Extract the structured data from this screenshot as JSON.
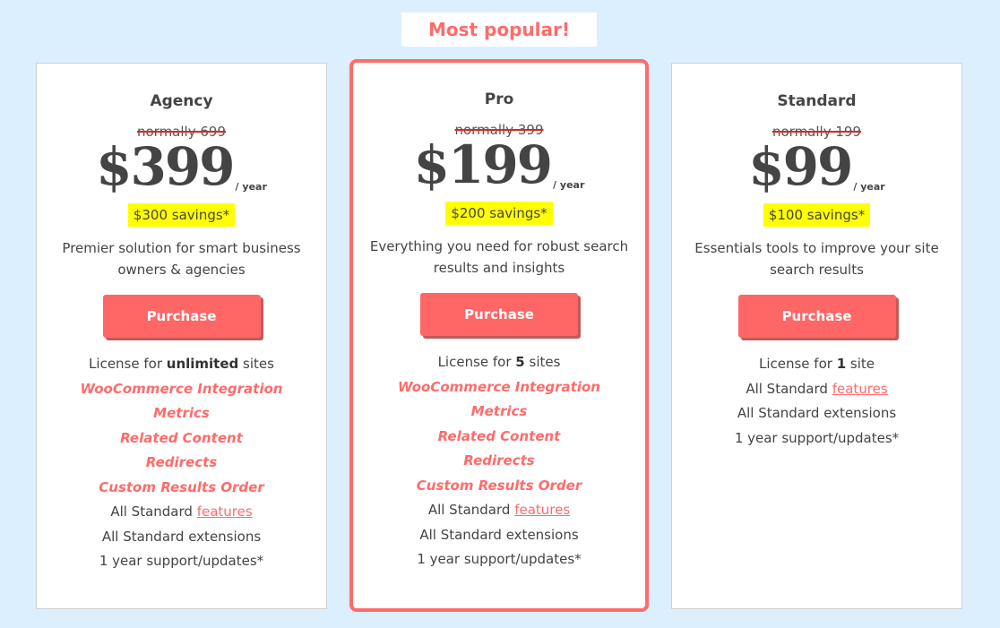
{
  "badge": {
    "label": "Most popular!"
  },
  "colors": {
    "background": "#dcefff",
    "accent": "#ff6b6b",
    "highlight": "#ffff00",
    "text": "#444444"
  },
  "plans": [
    {
      "name": "Agency",
      "normally": "normally 699",
      "price": "$399",
      "period": "/ year",
      "savings": "$300 savings*",
      "description": "Premier solution for smart business owners & agencies",
      "button": "Purchase",
      "license": {
        "prefix": "License for ",
        "bold": "unlimited",
        "suffix": " sites"
      },
      "premium_features": [
        "WooCommerce Integration",
        "Metrics",
        "Related Content",
        "Redirects",
        "Custom Results Order"
      ],
      "standard_features": {
        "prefix": "All Standard ",
        "link": "features"
      },
      "extensions": "All Standard extensions",
      "support": "1 year support/updates*"
    },
    {
      "name": "Pro",
      "normally": "normally 399",
      "price": "$199",
      "period": "/ year",
      "savings": "$200 savings*",
      "description": "Everything you need for robust search results and insights",
      "button": "Purchase",
      "license": {
        "prefix": "License for ",
        "bold": "5",
        "suffix": " sites"
      },
      "premium_features": [
        "WooCommerce Integration",
        "Metrics",
        "Related Content",
        "Redirects",
        "Custom Results Order"
      ],
      "standard_features": {
        "prefix": "All Standard ",
        "link": "features"
      },
      "extensions": "All Standard extensions",
      "support": "1 year support/updates*"
    },
    {
      "name": "Standard",
      "normally": "normally 199",
      "price": "$99",
      "period": "/ year",
      "savings": "$100 savings*",
      "description": "Essentials tools to improve your site search results",
      "button": "Purchase",
      "license": {
        "prefix": "License for ",
        "bold": "1",
        "suffix": " site"
      },
      "premium_features": [],
      "standard_features": {
        "prefix": "All Standard ",
        "link": "features"
      },
      "extensions": "All Standard extensions",
      "support": "1 year support/updates*"
    }
  ]
}
